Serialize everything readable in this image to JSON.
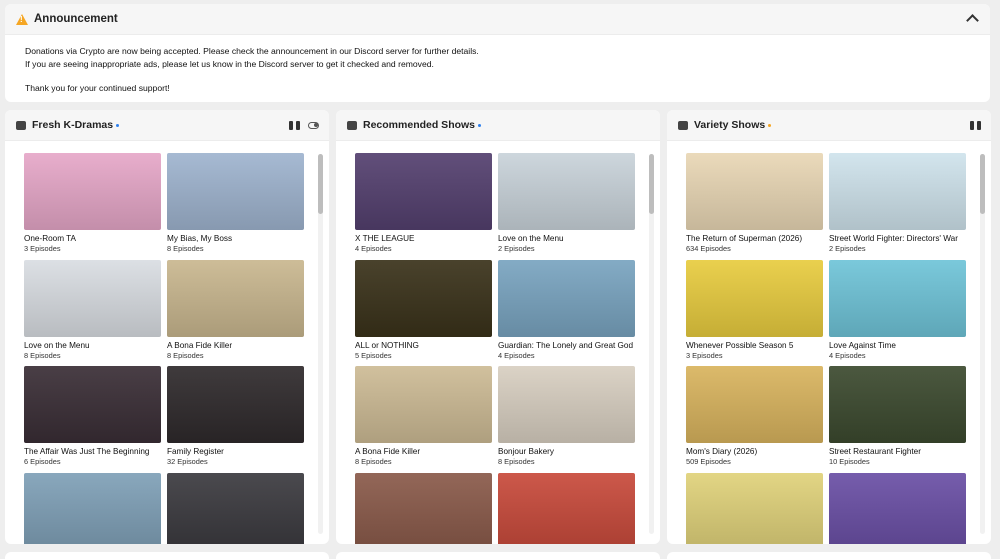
{
  "announcement": {
    "title": "Announcement",
    "lines": [
      "Donations via Crypto are now being accepted. Please check the announcement in our Discord server for further details.",
      "If you are seeing inappropriate ads, please let us know in the Discord server to get it checked and removed.",
      "Thank you for your continued support!"
    ]
  },
  "panels": [
    {
      "title": "Fresh K-Dramas",
      "shows": [
        {
          "title": "One-Room TA",
          "episodes": "3 Episodes",
          "color": "#e6a7c8"
        },
        {
          "title": "My Bias, My Boss",
          "episodes": "8 Episodes",
          "color": "#9fb4cf"
        },
        {
          "title": "Love on the Menu",
          "episodes": "8 Episodes",
          "color": "#d9dde2"
        },
        {
          "title": "A Bona Fide Killer",
          "episodes": "8 Episodes",
          "color": "#c9b78f"
        },
        {
          "title": "The Affair Was Just The Beginning",
          "episodes": "6 Episodes",
          "color": "#3a2e36"
        },
        {
          "title": "Family Register",
          "episodes": "32 Episodes",
          "color": "#2f2a2c"
        },
        {
          "title": "",
          "episodes": "",
          "color": "#7fa0b7"
        },
        {
          "title": "",
          "episodes": "",
          "color": "#3b3a3f"
        }
      ]
    },
    {
      "title": "Recommended Shows",
      "shows": [
        {
          "title": "X THE LEAGUE",
          "episodes": "4 Episodes",
          "color": "#54406f"
        },
        {
          "title": "Love on the Menu",
          "episodes": "2 Episodes",
          "color": "#c9d3da"
        },
        {
          "title": "ALL or NOTHING",
          "episodes": "5 Episodes",
          "color": "#3a321a"
        },
        {
          "title": "Guardian: The Lonely and Great God",
          "episodes": "4 Episodes",
          "color": "#79a4c0"
        },
        {
          "title": "A Bona Fide Killer",
          "episodes": "8 Episodes",
          "color": "#cdbb95"
        },
        {
          "title": "Bonjour Bakery",
          "episodes": "8 Episodes",
          "color": "#d8cfc1"
        },
        {
          "title": "",
          "episodes": "",
          "color": "#8a5a4a"
        },
        {
          "title": "",
          "episodes": "",
          "color": "#c84a3b"
        }
      ]
    },
    {
      "title": "Variety Shows",
      "shows": [
        {
          "title": "The Return of Superman (2026)",
          "episodes": "634 Episodes",
          "color": "#e9d7b5"
        },
        {
          "title": "Street World Fighter: Directors' War",
          "episodes": "2 Episodes",
          "color": "#cfe3ec"
        },
        {
          "title": "Whenever Possible Season 5",
          "episodes": "3 Episodes",
          "color": "#e8cc3f"
        },
        {
          "title": "Love Against Time",
          "episodes": "4 Episodes",
          "color": "#6fc4d8"
        },
        {
          "title": "Mom's Diary (2026)",
          "episodes": "509 Episodes",
          "color": "#d9b45e"
        },
        {
          "title": "Street Restaurant Fighter",
          "episodes": "10 Episodes",
          "color": "#3c4a2f"
        },
        {
          "title": "",
          "episodes": "",
          "color": "#e0d27a"
        },
        {
          "title": "",
          "episodes": "",
          "color": "#6a4fa5"
        }
      ]
    }
  ]
}
